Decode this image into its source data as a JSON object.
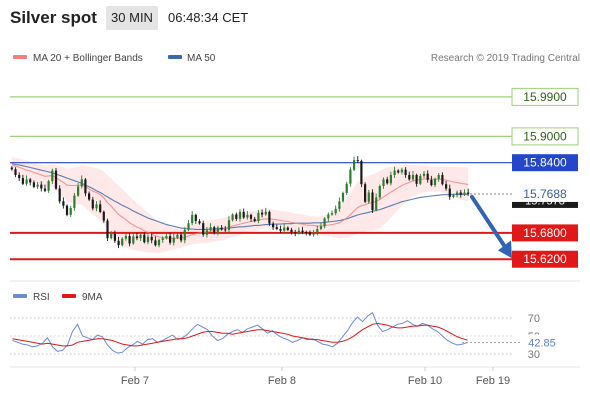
{
  "header": {
    "title": "Silver spot",
    "timeframe": "30 MIN",
    "time": "06:48:34 CET"
  },
  "legend": {
    "ma20": "MA 20 + Bollinger Bands",
    "ma50": "MA 50",
    "credit": "Research © 2019 Trading Central"
  },
  "colors": {
    "ma20": "#f07f7f",
    "ma50": "#3b6aa9",
    "resistance_green": "#9ed27a",
    "blue_level": "#2447c9",
    "red_level": "#e01818",
    "band_fill": "#fde0e0",
    "candle_up": "#2e7d2e",
    "candle_down": "#1a1a1a",
    "current_label": "#2a2a2a",
    "arrow": "#2f64b4",
    "rsi_line": "#6b8ad8",
    "rsi_ma": "#e01818"
  },
  "chart_data": {
    "type": "candlestick",
    "instrument": "Silver spot",
    "timeframe": "30 MIN",
    "y_range": [
      15.6,
      16.0
    ],
    "levels": [
      {
        "label": "15.9900",
        "value": 15.99,
        "kind": "green"
      },
      {
        "label": "15.9000",
        "value": 15.9,
        "kind": "green"
      },
      {
        "label": "15.8400",
        "value": 15.84,
        "kind": "blue"
      },
      {
        "label": "15.7688",
        "value": 15.7688,
        "kind": "current"
      },
      {
        "label": "15.6800",
        "value": 15.68,
        "kind": "red"
      },
      {
        "label": "15.6200",
        "value": 15.62,
        "kind": "red"
      }
    ],
    "current_price": 15.7688,
    "hidden_label": "15.7578",
    "x_labels": [
      "Feb 7",
      "Feb 8",
      "Feb 10",
      "Feb 19"
    ],
    "closes": [
      15.825,
      15.812,
      15.805,
      15.792,
      15.802,
      15.795,
      15.785,
      15.79,
      15.781,
      15.776,
      15.798,
      15.822,
      15.781,
      15.752,
      15.742,
      15.721,
      15.737,
      15.765,
      15.786,
      15.802,
      15.77,
      15.756,
      15.736,
      15.745,
      15.728,
      15.708,
      15.668,
      15.678,
      15.662,
      15.652,
      15.667,
      15.673,
      15.656,
      15.672,
      15.668,
      15.676,
      15.659,
      15.671,
      15.663,
      15.652,
      15.664,
      15.668,
      15.673,
      15.658,
      15.669,
      15.676,
      15.663,
      15.687,
      15.702,
      15.721,
      15.707,
      15.702,
      15.676,
      15.686,
      15.693,
      15.681,
      15.692,
      15.688,
      15.687,
      15.709,
      15.722,
      15.712,
      15.728,
      15.715,
      15.721,
      15.712,
      15.707,
      15.726,
      15.722,
      15.728,
      15.701,
      15.693,
      15.689,
      15.685,
      15.692,
      15.687,
      15.681,
      15.679,
      15.685,
      15.682,
      15.681,
      15.676,
      15.681,
      15.689,
      15.695,
      15.713,
      15.722,
      15.725,
      15.735,
      15.752,
      15.771,
      15.792,
      15.824,
      15.846,
      15.844,
      15.791,
      15.751,
      15.772,
      15.732,
      15.761,
      15.787,
      15.802,
      15.793,
      15.812,
      15.822,
      15.818,
      15.824,
      15.812,
      15.802,
      15.812,
      15.792,
      15.81,
      15.815,
      15.801,
      15.789,
      15.803,
      15.812,
      15.791,
      15.781,
      15.762,
      15.766,
      15.772,
      15.767,
      15.772,
      15.769
    ],
    "ma20": [
      15.835,
      15.832,
      15.83,
      15.826,
      15.823,
      15.821,
      15.818,
      15.815,
      15.812,
      15.809,
      15.81,
      15.811,
      15.806,
      15.8,
      15.795,
      15.789,
      15.788,
      15.788,
      15.788,
      15.789,
      15.785,
      15.78,
      15.775,
      15.772,
      15.767,
      15.76,
      15.749,
      15.741,
      15.731,
      15.722,
      15.716,
      15.71,
      15.703,
      15.698,
      15.693,
      15.69,
      15.685,
      15.681,
      15.677,
      15.673,
      15.671,
      15.669,
      15.668,
      15.668,
      15.667,
      15.668,
      15.668,
      15.67,
      15.673,
      15.676,
      15.678,
      15.68,
      15.68,
      15.682,
      15.684,
      15.685,
      15.687,
      15.688,
      15.69,
      15.693,
      15.696,
      15.698,
      15.7,
      15.702,
      15.704,
      15.706,
      15.707,
      15.709,
      15.711,
      15.712,
      15.712,
      15.711,
      15.71,
      15.708,
      15.707,
      15.706,
      15.704,
      15.702,
      15.701,
      15.7,
      15.698,
      15.697,
      15.697,
      15.696,
      15.696,
      15.697,
      15.698,
      15.699,
      15.701,
      15.703,
      15.708,
      15.714,
      15.722,
      15.73,
      15.738,
      15.742,
      15.744,
      15.748,
      15.749,
      15.752,
      15.756,
      15.762,
      15.767,
      15.773,
      15.778,
      15.783,
      15.788,
      15.792,
      15.795,
      15.799,
      15.8,
      15.802,
      15.803,
      15.803,
      15.803,
      15.802,
      15.803,
      15.802,
      15.8,
      15.798,
      15.796,
      15.795,
      15.793,
      15.792,
      15.79
    ],
    "ma50": [
      15.838,
      15.836,
      15.835,
      15.833,
      15.831,
      15.829,
      15.827,
      15.825,
      15.823,
      15.821,
      15.819,
      15.817,
      15.814,
      15.811,
      15.808,
      15.805,
      15.802,
      15.799,
      15.796,
      15.793,
      15.789,
      15.785,
      15.781,
      15.776,
      15.772,
      15.767,
      15.762,
      15.757,
      15.752,
      15.748,
      15.743,
      15.739,
      15.735,
      15.73,
      15.726,
      15.722,
      15.718,
      15.714,
      15.711,
      15.708,
      15.705,
      15.702,
      15.699,
      15.697,
      15.695,
      15.693,
      15.691,
      15.69,
      15.689,
      15.689,
      15.688,
      15.688,
      15.688,
      15.688,
      15.689,
      15.689,
      15.69,
      15.69,
      15.691,
      15.691,
      15.692,
      15.693,
      15.694,
      15.694,
      15.695,
      15.696,
      15.697,
      15.697,
      15.698,
      15.699,
      15.699,
      15.7,
      15.7,
      15.7,
      15.701,
      15.701,
      15.701,
      15.702,
      15.702,
      15.702,
      15.702,
      15.702,
      15.703,
      15.703,
      15.703,
      15.704,
      15.705,
      15.706,
      15.707,
      15.708,
      15.71,
      15.712,
      15.715,
      15.718,
      15.721,
      15.723,
      15.725,
      15.727,
      15.729,
      15.731,
      15.733,
      15.736,
      15.739,
      15.742,
      15.745,
      15.748,
      15.751,
      15.753,
      15.755,
      15.757,
      15.759,
      15.761,
      15.762,
      15.763,
      15.764,
      15.765,
      15.766,
      15.767,
      15.767,
      15.767,
      15.768,
      15.768,
      15.768,
      15.768,
      15.768
    ],
    "bb_width": [
      0.018,
      0.019,
      0.02,
      0.021,
      0.022,
      0.022,
      0.023,
      0.023,
      0.024,
      0.024,
      0.025,
      0.026,
      0.028,
      0.031,
      0.034,
      0.037,
      0.039,
      0.041,
      0.043,
      0.045,
      0.048,
      0.051,
      0.054,
      0.056,
      0.058,
      0.06,
      0.062,
      0.063,
      0.064,
      0.065,
      0.064,
      0.062,
      0.06,
      0.057,
      0.054,
      0.051,
      0.048,
      0.045,
      0.042,
      0.039,
      0.036,
      0.033,
      0.03,
      0.027,
      0.025,
      0.023,
      0.022,
      0.021,
      0.021,
      0.022,
      0.023,
      0.024,
      0.024,
      0.025,
      0.025,
      0.025,
      0.025,
      0.025,
      0.025,
      0.025,
      0.025,
      0.025,
      0.024,
      0.024,
      0.023,
      0.023,
      0.023,
      0.022,
      0.022,
      0.022,
      0.022,
      0.022,
      0.022,
      0.022,
      0.022,
      0.022,
      0.022,
      0.022,
      0.022,
      0.022,
      0.022,
      0.021,
      0.021,
      0.021,
      0.022,
      0.023,
      0.025,
      0.028,
      0.032,
      0.036,
      0.04,
      0.045,
      0.05,
      0.055,
      0.058,
      0.06,
      0.062,
      0.063,
      0.064,
      0.065,
      0.065,
      0.064,
      0.062,
      0.058,
      0.054,
      0.05,
      0.046,
      0.042,
      0.039,
      0.036,
      0.034,
      0.032,
      0.03,
      0.029,
      0.028,
      0.028,
      0.028,
      0.029,
      0.031,
      0.033,
      0.035,
      0.036,
      0.037,
      0.038,
      0.038
    ],
    "rsi": {
      "legend_rsi": "RSI",
      "legend_ma": "9MA",
      "ticks": [
        "70",
        "50",
        "30"
      ],
      "current_label": "42.85",
      "y_range": [
        20,
        80
      ],
      "values": [
        45,
        43,
        41,
        40,
        38,
        39,
        42,
        48,
        38,
        33,
        34,
        40,
        55,
        63,
        50,
        48,
        46,
        51,
        49,
        40,
        34,
        31,
        32,
        37,
        40,
        44,
        41,
        46,
        47,
        43,
        45,
        48,
        51,
        46,
        48,
        52,
        58,
        63,
        60,
        57,
        50,
        45,
        47,
        52,
        55,
        57,
        54,
        58,
        60,
        62,
        58,
        53,
        56,
        51,
        48,
        46,
        43,
        45,
        48,
        46,
        47,
        44,
        41,
        40,
        38,
        42,
        49,
        56,
        65,
        71,
        66,
        72,
        76,
        62,
        55,
        57,
        60,
        63,
        64,
        67,
        63,
        61,
        64,
        62,
        58,
        55,
        50,
        45,
        42,
        40,
        41,
        42.85
      ],
      "ma_values": [
        47,
        46,
        45,
        44,
        43,
        42,
        41,
        42,
        41,
        40,
        39,
        39,
        40,
        43,
        44,
        45,
        46,
        47,
        47,
        46,
        45,
        43,
        41,
        40,
        39,
        39,
        40,
        41,
        42,
        43,
        44,
        45,
        46,
        47,
        47,
        48,
        50,
        52,
        54,
        55,
        55,
        54,
        53,
        53,
        52,
        53,
        54,
        55,
        56,
        57,
        57,
        56,
        55,
        54,
        53,
        52,
        50,
        49,
        48,
        47,
        46,
        46,
        45,
        44,
        43,
        43,
        44,
        46,
        49,
        53,
        57,
        60,
        63,
        64,
        63,
        62,
        60,
        59,
        59,
        60,
        61,
        61,
        62,
        62,
        61,
        60,
        58,
        55,
        52,
        49,
        47,
        45.5
      ]
    }
  }
}
